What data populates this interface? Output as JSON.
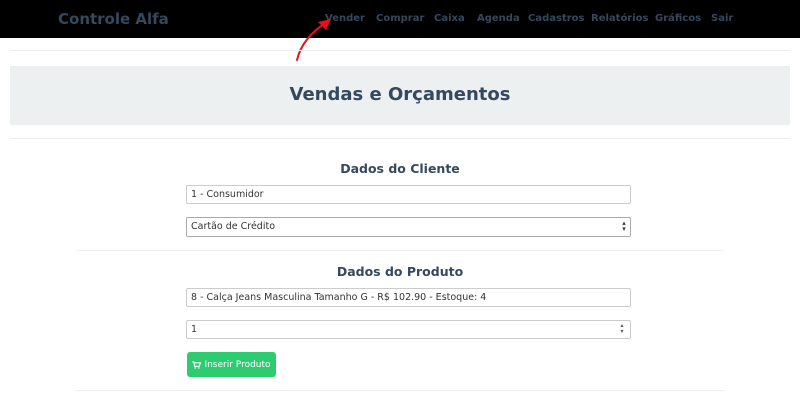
{
  "navbar": {
    "brand": "Controle Alfa",
    "items": [
      {
        "label": "Vender"
      },
      {
        "label": "Comprar"
      },
      {
        "label": "Caixa"
      },
      {
        "label": "Agenda"
      },
      {
        "label": "Cadastros"
      },
      {
        "label": "Relatórios"
      },
      {
        "label": "Gráficos"
      },
      {
        "label": "Sair"
      }
    ]
  },
  "page": {
    "title": "Vendas e Orçamentos"
  },
  "cliente": {
    "section_title": "Dados do Cliente",
    "cliente_value": "1 - Consumidor",
    "pagamento_value": "Cartão de Crédito"
  },
  "produto": {
    "section_title": "Dados do Produto",
    "produto_value": "8 - Calça Jeans Masculina Tamanho G - R$ 102.90 - Estoque: 4",
    "quantidade_value": "1",
    "insert_button_label": "Inserir Produto"
  },
  "colors": {
    "navbar_bg": "#000000",
    "nav_text": "#34495e",
    "annotation_arrow": "#e8101c",
    "jumbotron_bg": "#ecf0f1",
    "button_green": "#2ecc71"
  },
  "icons": {
    "insert_button_icon": "shopping-cart-icon",
    "annotation": "red-arrow-icon"
  }
}
